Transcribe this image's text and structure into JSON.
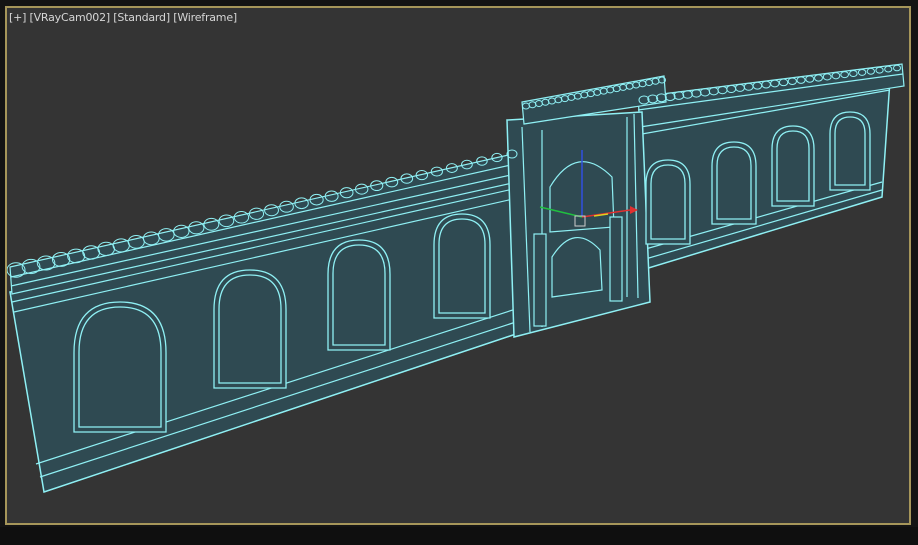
{
  "viewport": {
    "labels": {
      "menu": "[+]",
      "camera": "[VRayCam002]",
      "shading": "[Standard]",
      "display": "[Wireframe]"
    },
    "background_color": "#343434",
    "border_color": "#a6965a",
    "wire_color": "#8ff0f4",
    "fill_color": "#2f4a52"
  },
  "scene": {
    "object": "arched wall with central gateway (wireframe)",
    "gizmo": {
      "x_axis_color": "#e03030",
      "y_axis_color": "#20c040",
      "z_axis_color": "#3050e0"
    }
  }
}
